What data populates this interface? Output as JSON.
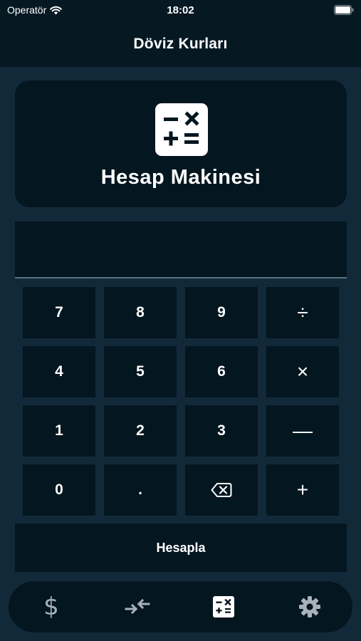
{
  "status_bar": {
    "carrier": "Operatör",
    "time": "18:02"
  },
  "nav": {
    "title": "Döviz Kurları"
  },
  "header": {
    "title": "Hesap Makinesi",
    "icon": "calculator-icon"
  },
  "display": {
    "value": ""
  },
  "keypad": {
    "keys": [
      "7",
      "8",
      "9",
      "÷",
      "4",
      "5",
      "6",
      "×",
      "1",
      "2",
      "3",
      "—",
      "0",
      ".",
      "backspace",
      "+"
    ]
  },
  "calculate_button": {
    "label": "Hesapla"
  },
  "tab_bar": {
    "tabs": [
      {
        "icon": "dollar-icon",
        "glyph": "$"
      },
      {
        "icon": "exchange-arrows-icon"
      },
      {
        "icon": "calculator-icon",
        "active": true
      },
      {
        "icon": "gear-icon"
      }
    ]
  },
  "colors": {
    "background": "#12293a",
    "card": "#041620",
    "bar": "#061923",
    "inactive_icon": "#a7b2ba",
    "active_icon": "#ffffff"
  }
}
